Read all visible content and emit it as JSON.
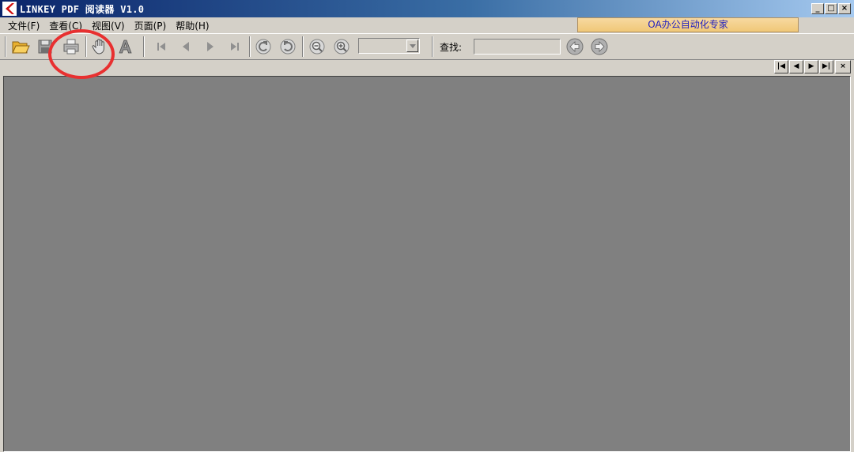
{
  "window": {
    "title": "LINKEY PDF 阅读器 V1.0",
    "controls": {
      "minimize": "_",
      "maximize": "□",
      "close": "×"
    }
  },
  "menu": {
    "items": [
      {
        "label": "文件(F)"
      },
      {
        "label": "查看(C)"
      },
      {
        "label": "视图(V)"
      },
      {
        "label": "页面(P)"
      },
      {
        "label": "帮助(H)"
      }
    ]
  },
  "banner": {
    "text": "OA办公自动化专家"
  },
  "toolbar": {
    "buttons": [
      {
        "name": "open-icon"
      },
      {
        "name": "save-icon"
      },
      {
        "name": "print-icon"
      },
      {
        "name": "hand-tool-icon"
      },
      {
        "name": "text-select-icon"
      },
      {
        "name": "first-page-icon"
      },
      {
        "name": "prev-page-icon"
      },
      {
        "name": "next-page-icon"
      },
      {
        "name": "last-page-icon"
      },
      {
        "name": "rotate-left-icon"
      },
      {
        "name": "rotate-right-icon"
      },
      {
        "name": "zoom-out-icon"
      },
      {
        "name": "zoom-in-icon"
      }
    ],
    "zoom_value": "",
    "find_label": "查找:",
    "find_value": "",
    "find_prev": "find-prev-icon",
    "find_next": "find-next-icon"
  },
  "nav_strip": {
    "first": "|◀",
    "prev": "◀",
    "next": "▶",
    "last": "▶|",
    "close": "×"
  },
  "colors": {
    "highlight": "#e83030",
    "document_bg": "#808080",
    "banner_text": "#2020c0"
  }
}
